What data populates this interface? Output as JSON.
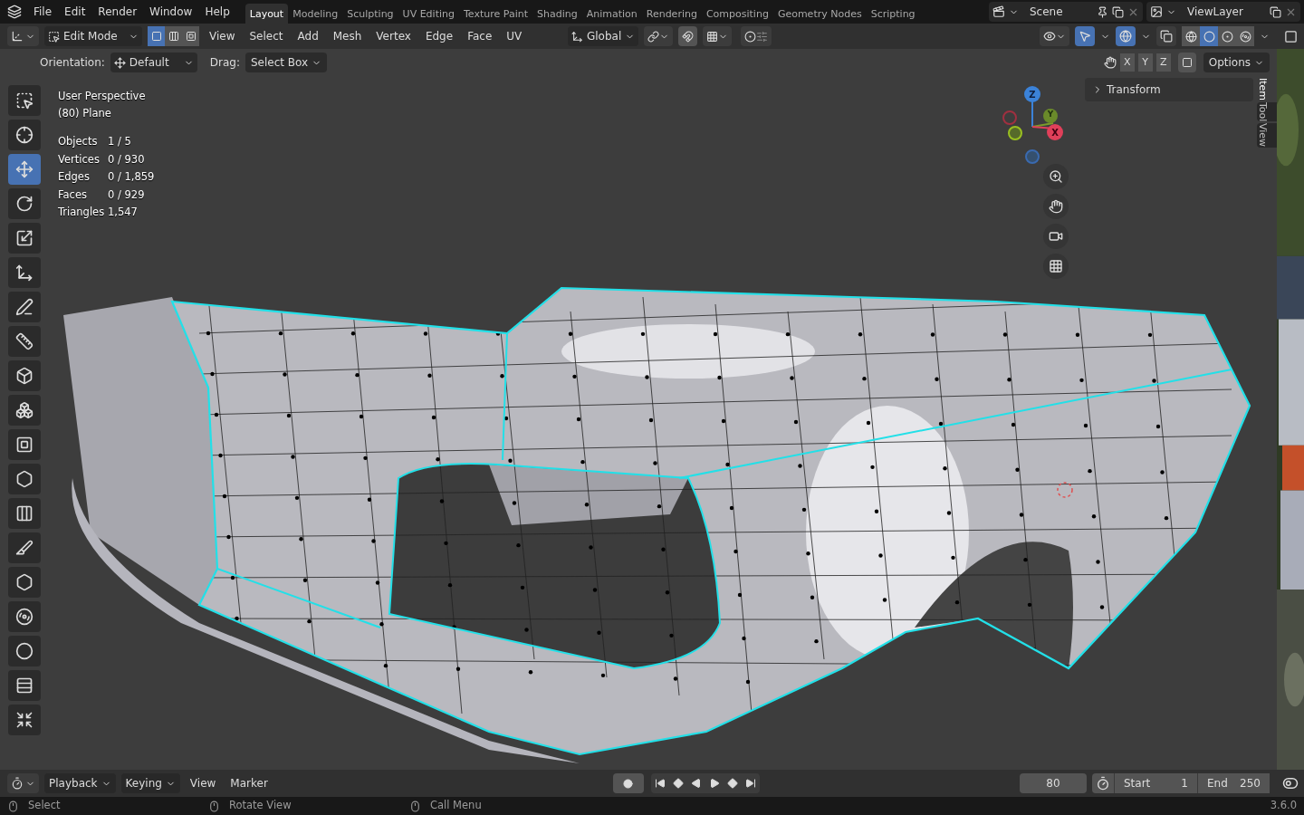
{
  "menu": [
    "File",
    "Edit",
    "Render",
    "Window",
    "Help"
  ],
  "workspaces": [
    {
      "label": "Layout",
      "selected": true
    },
    {
      "label": "Modeling",
      "selected": false
    },
    {
      "label": "Sculpting",
      "selected": false
    },
    {
      "label": "UV Editing",
      "selected": false
    },
    {
      "label": "Texture Paint",
      "selected": false
    },
    {
      "label": "Shading",
      "selected": false
    },
    {
      "label": "Animation",
      "selected": false
    },
    {
      "label": "Rendering",
      "selected": false
    },
    {
      "label": "Compositing",
      "selected": false
    },
    {
      "label": "Geometry Nodes",
      "selected": false
    },
    {
      "label": "Scripting",
      "selected": false
    }
  ],
  "scene": "Scene",
  "view_layer": "ViewLayer",
  "header": {
    "mode": "Edit Mode",
    "select_modes": [
      {
        "kind": "vertex",
        "selected": true
      },
      {
        "kind": "edge",
        "selected": false
      },
      {
        "kind": "face",
        "selected": false
      }
    ],
    "menus": [
      "View",
      "Select",
      "Add",
      "Mesh",
      "Vertex",
      "Edge",
      "Face",
      "UV"
    ],
    "orientation": "Global",
    "snap_on": false,
    "overlays_on": true,
    "xray_on": false,
    "shading": [
      {
        "kind": "wireframe",
        "selected": false
      },
      {
        "kind": "solid",
        "selected": true
      },
      {
        "kind": "material",
        "selected": false
      },
      {
        "kind": "rendered",
        "selected": false
      }
    ]
  },
  "tool_options": {
    "orientation_label": "Orientation:",
    "orientation": "Default",
    "drag_label": "Drag:",
    "drag": "Select Box",
    "axes": [
      "X",
      "Y",
      "Z"
    ],
    "options": "Options"
  },
  "overlay": {
    "title": "User Perspective",
    "object": "(80) Plane",
    "stats": [
      {
        "label": "Objects",
        "value": "1 / 5"
      },
      {
        "label": "Vertices",
        "value": "0 / 930"
      },
      {
        "label": "Edges",
        "value": "0 / 1,859"
      },
      {
        "label": "Faces",
        "value": "0 / 929"
      },
      {
        "label": "Triangles",
        "value": "1,547"
      }
    ]
  },
  "gizmo": {
    "z": "Z",
    "y": "Y",
    "x": "X"
  },
  "tools": [
    {
      "kind": "select",
      "selected": false
    },
    {
      "kind": "cursor",
      "selected": false
    },
    {
      "kind": "move",
      "selected": true
    },
    {
      "kind": "rotate",
      "selected": false
    },
    {
      "kind": "scale",
      "selected": false
    },
    {
      "kind": "transform",
      "selected": false
    },
    {
      "kind": "annotate",
      "selected": false
    },
    {
      "kind": "measure",
      "selected": false
    },
    {
      "kind": "add_cube",
      "selected": false
    },
    {
      "kind": "extrude",
      "selected": false
    },
    {
      "kind": "inset",
      "selected": false
    },
    {
      "kind": "bevel",
      "selected": false
    },
    {
      "kind": "loop_cut",
      "selected": false
    },
    {
      "kind": "knife",
      "selected": false
    },
    {
      "kind": "poly_build",
      "selected": false
    },
    {
      "kind": "spin",
      "selected": false
    },
    {
      "kind": "smooth",
      "selected": false
    },
    {
      "kind": "edge_slide",
      "selected": false
    },
    {
      "kind": "shrink",
      "selected": false
    }
  ],
  "sidebar": {
    "panel": "Transform",
    "tabs": [
      {
        "label": "Item",
        "selected": true
      },
      {
        "label": "Tool",
        "selected": false
      },
      {
        "label": "View",
        "selected": false
      }
    ]
  },
  "timeline": {
    "auto_keying_on": false,
    "menus": [
      "Playback",
      "Keying",
      "View",
      "Marker"
    ],
    "current": "80",
    "start_label": "Start",
    "start": "1",
    "end_label": "End",
    "end": "250"
  },
  "status": [
    {
      "label": "Select"
    },
    {
      "label": "Rotate View"
    },
    {
      "label": "Call Menu"
    }
  ],
  "version": "3.6.0"
}
